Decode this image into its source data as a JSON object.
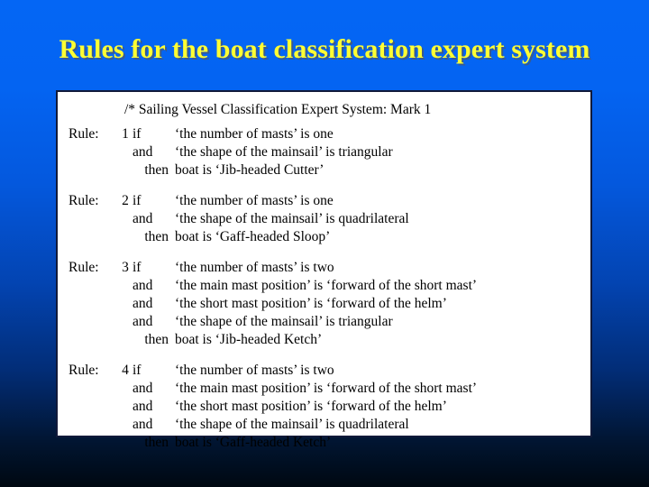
{
  "slide": {
    "title": "Rules for the boat classification expert system",
    "title_color": "#ffff33",
    "background_top_color": "#0466f5",
    "background_bottom_color": "#000811",
    "panel_background": "#ffffff",
    "panel_border_color": "#111a3a"
  },
  "panel": {
    "comment": "/* Sailing Vessel Classification Expert System: Mark 1",
    "rule_label": "Rule:",
    "rules": [
      {
        "number": "1",
        "lines": [
          {
            "connective": "if",
            "clause": "‘the number of masts’ is one"
          },
          {
            "connective": "and",
            "clause": "‘the shape of the mainsail’ is triangular"
          },
          {
            "connective": "then",
            "clause": "boat is ‘Jib-headed Cutter’"
          }
        ]
      },
      {
        "number": "2",
        "lines": [
          {
            "connective": "if",
            "clause": "‘the number of masts’ is one"
          },
          {
            "connective": "and",
            "clause": "‘the shape of the mainsail’ is quadrilateral"
          },
          {
            "connective": "then",
            "clause": "boat is ‘Gaff-headed Sloop’"
          }
        ]
      },
      {
        "number": "3",
        "lines": [
          {
            "connective": "if",
            "clause": "‘the number of masts’ is two"
          },
          {
            "connective": "and",
            "clause": "‘the main mast position’ is ‘forward of the short mast’"
          },
          {
            "connective": "and",
            "clause": "‘the short mast position’ is ‘forward of the helm’"
          },
          {
            "connective": "and",
            "clause": "‘the shape of the mainsail’ is triangular"
          },
          {
            "connective": "then",
            "clause": "boat is ‘Jib-headed Ketch’"
          }
        ]
      },
      {
        "number": "4",
        "lines": [
          {
            "connective": "if",
            "clause": "‘the number of masts’ is two"
          },
          {
            "connective": "and",
            "clause": "‘the main mast position’ is ‘forward of the short mast’"
          },
          {
            "connective": "and",
            "clause": "‘the short mast position’ is ‘forward of the helm’"
          },
          {
            "connective": "and",
            "clause": "‘the shape of the mainsail’ is quadrilateral"
          },
          {
            "connective": "then",
            "clause": "boat is ‘Gaff-headed Ketch’"
          }
        ]
      }
    ]
  }
}
